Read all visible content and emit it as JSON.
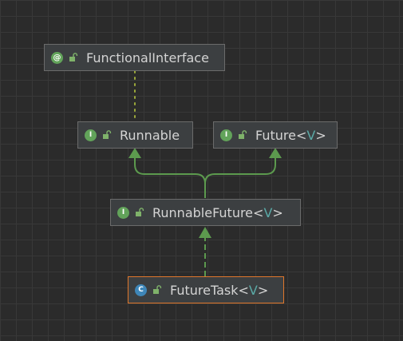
{
  "nodes": {
    "functional_interface": {
      "label": "FunctionalInterface",
      "kind": "annotation",
      "kind_glyph": "@",
      "lock_icon": "unlocked-padlock-icon"
    },
    "runnable": {
      "label": "Runnable",
      "kind": "interface",
      "kind_glyph": "I",
      "lock_icon": "unlocked-padlock-icon"
    },
    "future": {
      "label": "Future",
      "type_open": "<",
      "type_param": "V",
      "type_close": ">",
      "kind": "interface",
      "kind_glyph": "I",
      "lock_icon": "unlocked-padlock-icon"
    },
    "runnable_future": {
      "label": "RunnableFuture",
      "type_open": "<",
      "type_param": "V",
      "type_close": ">",
      "kind": "interface",
      "kind_glyph": "I",
      "lock_icon": "unlocked-padlock-icon"
    },
    "future_task": {
      "label": "FutureTask",
      "type_open": "<",
      "type_param": "V",
      "type_close": ">",
      "kind": "class",
      "kind_glyph": "C",
      "lock_icon": "unlocked-padlock-icon",
      "selected": true
    }
  },
  "colors": {
    "background": "#2b2b2b",
    "grid": "#383838",
    "node_fill": "#3c3f41",
    "node_border": "#6b6b6b",
    "selection_border": "#e0772b",
    "edge": "#5c9a4e",
    "annotation_edge": "#9aa83a",
    "type_param": "#5aa9a6"
  }
}
